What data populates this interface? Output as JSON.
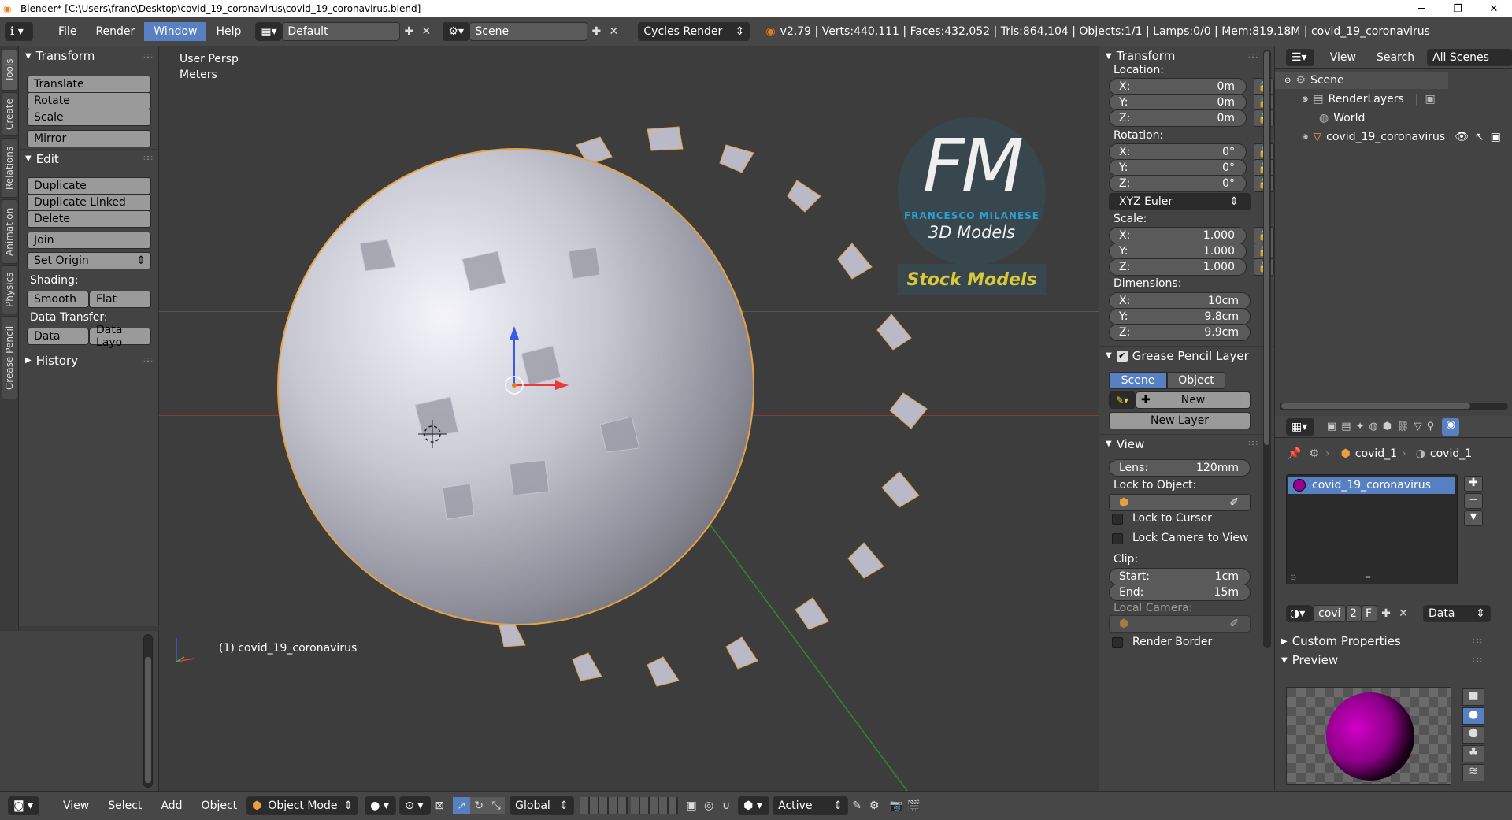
{
  "window": {
    "title": "Blender* [C:\\Users\\franc\\Desktop\\covid_19_coronavirus\\covid_19_coronavirus.blend]",
    "minimize": "─",
    "maximize": "❐",
    "close": "✕"
  },
  "topbar": {
    "menus": [
      "File",
      "Render",
      "Window",
      "Help"
    ],
    "screen_layout": "Default",
    "scene": "Scene",
    "engine": "Cycles Render",
    "stats": "v2.79 | Verts:440,111 | Faces:432,052 | Tris:864,104 | Objects:1/1 | Lamps:0/0 | Mem:819.18M | covid_19_coronavirus"
  },
  "left_tabs": [
    "Tools",
    "Create",
    "Relations",
    "Animation",
    "Physics",
    "Grease Pencil"
  ],
  "tool_panel": {
    "transform_header": "Transform",
    "translate": "Translate",
    "rotate": "Rotate",
    "scale": "Scale",
    "mirror": "Mirror",
    "edit_header": "Edit",
    "duplicate": "Duplicate",
    "duplicate_linked": "Duplicate Linked",
    "delete": "Delete",
    "join": "Join",
    "set_origin": "Set Origin",
    "shading_label": "Shading:",
    "smooth": "Smooth",
    "flat": "Flat",
    "data_transfer_label": "Data Transfer:",
    "data": "Data",
    "data_layout": "Data Layo",
    "history_header": "History"
  },
  "viewport": {
    "view_name": "User Persp",
    "units": "Meters",
    "object_label": "(1) covid_19_coronavirus",
    "logo_letters": "FM",
    "logo_name": "FRANCESCO MILANESE",
    "logo_sub": "3D Models",
    "stock": "Stock Models"
  },
  "n_panel": {
    "transform_header": "Transform",
    "location_label": "Location:",
    "loc_x": "0m",
    "loc_y": "0m",
    "loc_z": "0m",
    "rotation_label": "Rotation:",
    "rot_x": "0°",
    "rot_y": "0°",
    "rot_z": "0°",
    "rotation_mode": "XYZ Euler",
    "scale_label": "Scale:",
    "scale_x": "1.000",
    "scale_y": "1.000",
    "scale_z": "1.000",
    "dimensions_label": "Dimensions:",
    "dim_x": "10cm",
    "dim_y": "9.8cm",
    "dim_z": "9.9cm",
    "x_label": "X:",
    "y_label": "Y:",
    "z_label": "Z:",
    "gp_header": "Grease Pencil Layer",
    "gp_scene": "Scene",
    "gp_object": "Object",
    "gp_new": "New",
    "gp_new_layer": "New Layer",
    "view_header": "View",
    "lens_label": "Lens:",
    "lens_value": "120mm",
    "lock_to_object": "Lock to Object:",
    "lock_to_cursor": "Lock to Cursor",
    "lock_camera": "Lock Camera to View",
    "clip_label": "Clip:",
    "clip_start_label": "Start:",
    "clip_start": "1cm",
    "clip_end_label": "End:",
    "clip_end": "15m",
    "local_camera": "Local Camera:",
    "render_border": "Render Border"
  },
  "outliner": {
    "view": "View",
    "search": "Search",
    "filter": "All Scenes",
    "items": [
      {
        "label": "Scene"
      },
      {
        "label": "RenderLayers"
      },
      {
        "label": "World"
      },
      {
        "label": "covid_19_coronavirus"
      }
    ]
  },
  "properties": {
    "breadcrumb_obj": "covid_1",
    "breadcrumb_mat": "covid_1",
    "material_slot": "covid_19_coronavirus",
    "mat_name": "covi",
    "users": "2",
    "fake": "F",
    "link": "Data",
    "custom_props": "Custom Properties",
    "preview": "Preview"
  },
  "bottombar": {
    "menus": [
      "View",
      "Select",
      "Add",
      "Object"
    ],
    "mode": "Object Mode",
    "orientation": "Global",
    "pivot": "Active"
  },
  "colors": {
    "accent": "#5680c2",
    "panel": "#434343",
    "header": "#474747",
    "viewport": "#3d3d3d",
    "logo_blue": "#29a9e0",
    "stock_yellow": "#e8d43a"
  }
}
